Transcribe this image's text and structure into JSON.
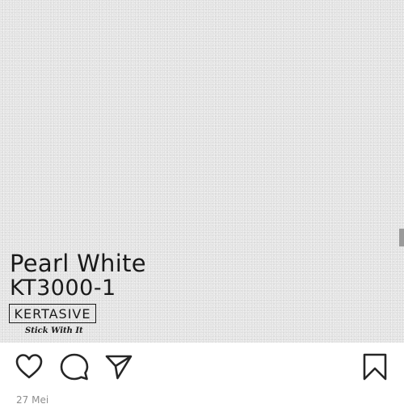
{
  "post": {
    "product_name": "Pearl White",
    "product_code": "KT3000-1",
    "brand": {
      "name": "KERTASIVE",
      "tagline": "Stick With It"
    },
    "date": "27 Mei"
  },
  "actions": {
    "like_icon": "heart-icon",
    "comment_icon": "comment-icon",
    "share_icon": "paper-plane-icon",
    "save_icon": "bookmark-icon"
  },
  "colors": {
    "photo_background": "#e3e3e3",
    "text": "#1a1a1a",
    "date_text": "#8e8e8e",
    "icon_stroke": "#262626"
  }
}
